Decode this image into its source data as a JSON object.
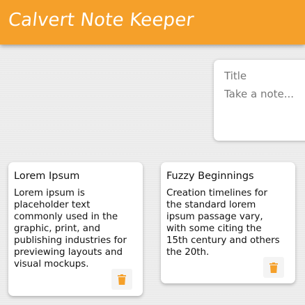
{
  "header": {
    "title": "Calvert Note Keeper"
  },
  "create_note": {
    "title_placeholder": "Title",
    "content_placeholder": "Take a note..."
  },
  "notes": [
    {
      "title": "Lorem Ipsum",
      "content": "Lorem ipsum is\nplaceholder text\ncommonly used in the\ngraphic, print, and\npublishing industries for\npreviewing layouts and\nvisual mockups.",
      "delete_icon": "trash-icon"
    },
    {
      "title": "Fuzzy Beginnings",
      "content": "Creation timelines for\nthe standard lorem\nipsum passage vary,\nwith some citing the\n15th century and others\nthe 20th.",
      "delete_icon": "trash-icon"
    }
  ],
  "colors": {
    "header_bg": "#f5a02a",
    "accent": "#f5a02a",
    "page_bg": "#eeeeee"
  }
}
